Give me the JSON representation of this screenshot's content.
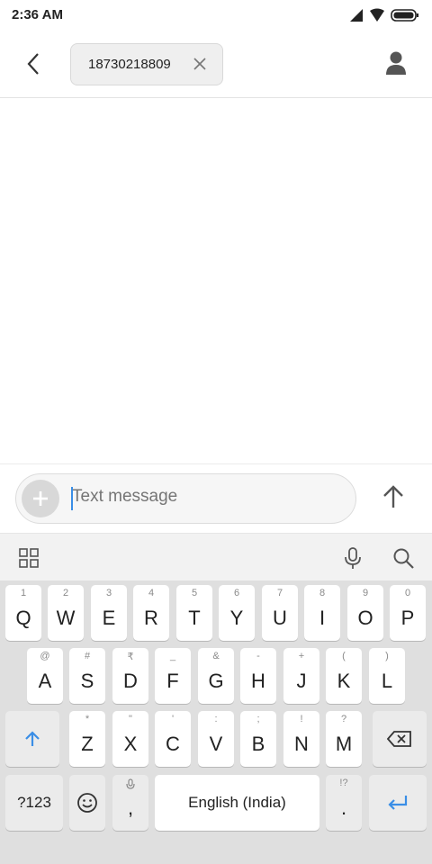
{
  "status_bar": {
    "time": "2:36 AM"
  },
  "header": {
    "recipient": "18730218809"
  },
  "composer": {
    "placeholder": "Text message"
  },
  "keyboard": {
    "row1": [
      {
        "hint": "1",
        "label": "Q"
      },
      {
        "hint": "2",
        "label": "W"
      },
      {
        "hint": "3",
        "label": "E"
      },
      {
        "hint": "4",
        "label": "R"
      },
      {
        "hint": "5",
        "label": "T"
      },
      {
        "hint": "6",
        "label": "Y"
      },
      {
        "hint": "7",
        "label": "U"
      },
      {
        "hint": "8",
        "label": "I"
      },
      {
        "hint": "9",
        "label": "O"
      },
      {
        "hint": "0",
        "label": "P"
      }
    ],
    "row2": [
      {
        "hint": "@",
        "label": "A"
      },
      {
        "hint": "#",
        "label": "S"
      },
      {
        "hint": "₹",
        "label": "D"
      },
      {
        "hint": "_",
        "label": "F"
      },
      {
        "hint": "&",
        "label": "G"
      },
      {
        "hint": "-",
        "label": "H"
      },
      {
        "hint": "+",
        "label": "J"
      },
      {
        "hint": "(",
        "label": "K"
      },
      {
        "hint": ")",
        "label": "L"
      }
    ],
    "row3": [
      {
        "hint": "*",
        "label": "Z"
      },
      {
        "hint": "\"",
        "label": "X"
      },
      {
        "hint": "'",
        "label": "C"
      },
      {
        "hint": ":",
        "label": "V"
      },
      {
        "hint": ";",
        "label": "B"
      },
      {
        "hint": "!",
        "label": "N"
      },
      {
        "hint": "?",
        "label": "M"
      }
    ],
    "symbols_label": "?123",
    "comma_label": ",",
    "space_label": "English (India)",
    "period_label": ".",
    "period_hint": "!?"
  },
  "colors": {
    "accent": "#3a8ee6",
    "keyboard_bg": "#dfdfdf"
  },
  "icons": [
    "back-arrow-icon",
    "close-icon",
    "contact-icon",
    "plus-icon",
    "send-arrow-icon",
    "apps-grid-icon",
    "microphone-icon",
    "search-icon",
    "shift-icon",
    "backspace-icon",
    "emoji-icon",
    "enter-icon"
  ]
}
